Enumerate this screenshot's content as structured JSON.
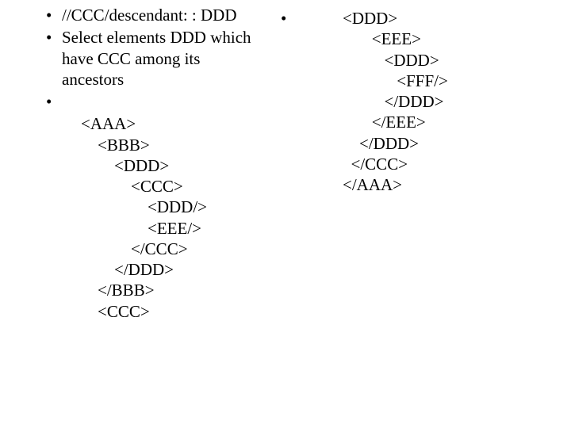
{
  "left": {
    "bullets": [
      "//CCC/descendant: : DDD",
      "Select elements DDD which have CCC among its ancestors",
      ""
    ],
    "code": "<AAA>\n    <BBB>\n        <DDD>\n            <CCC>\n                <DDD/>\n                <EEE/>\n            </CCC>\n        </DDD>\n    </BBB>\n    <CCC>"
  },
  "right": {
    "bullet": "",
    "code": "<DDD>\n       <EEE>\n          <DDD>\n             <FFF/>\n          </DDD>\n       </EEE>\n    </DDD>\n  </CCC>\n</AAA>"
  }
}
